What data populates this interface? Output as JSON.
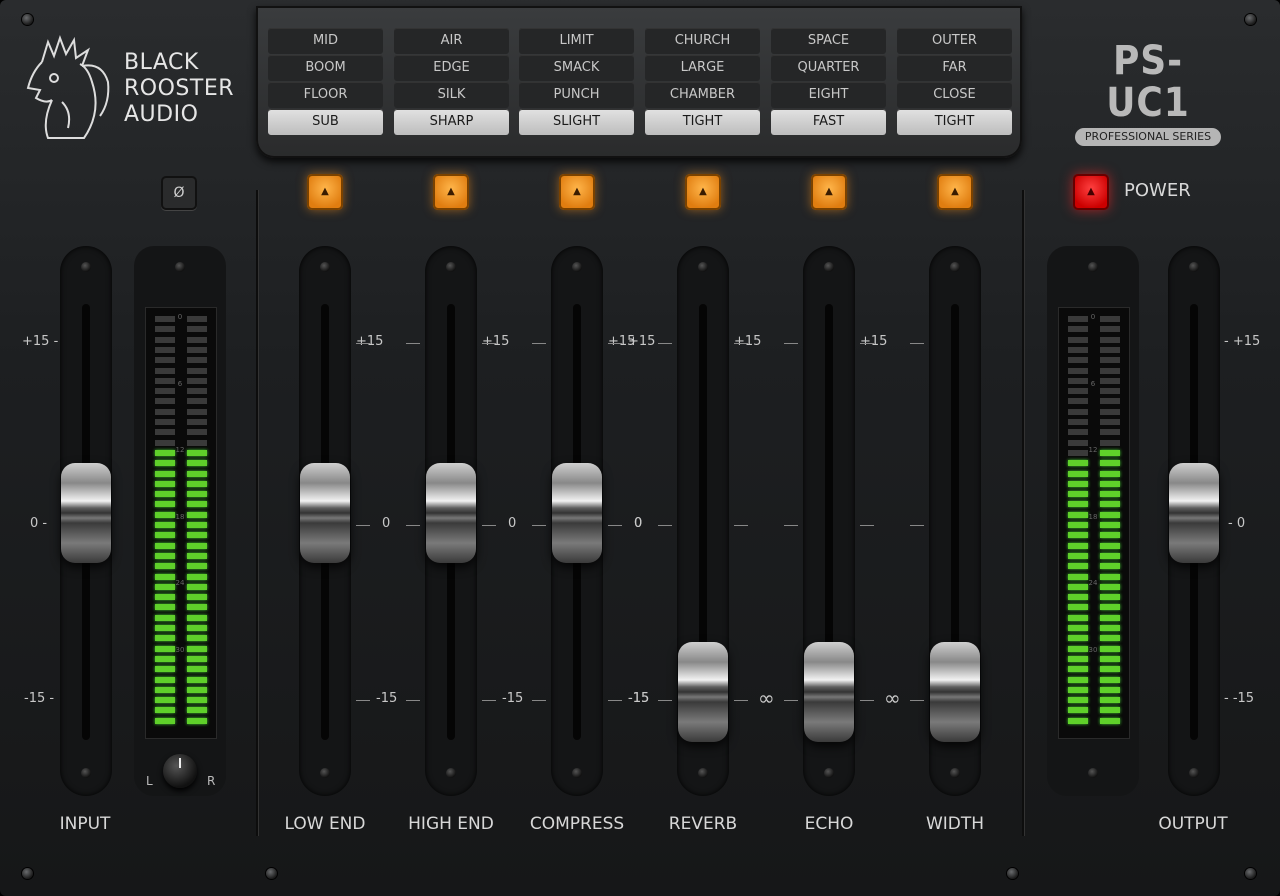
{
  "brand": {
    "line1": "BLACK",
    "line2": "ROOSTER",
    "line3": "AUDIO",
    "product": "PS-UC1",
    "series": "PROFESSIONAL SERIES"
  },
  "presets": [
    {
      "items": [
        "MID",
        "BOOM",
        "FLOOR",
        "SUB"
      ],
      "selected": 3
    },
    {
      "items": [
        "AIR",
        "EDGE",
        "SILK",
        "SHARP"
      ],
      "selected": 3
    },
    {
      "items": [
        "LIMIT",
        "SMACK",
        "PUNCH",
        "SLIGHT"
      ],
      "selected": 3
    },
    {
      "items": [
        "CHURCH",
        "LARGE",
        "CHAMBER",
        "TIGHT"
      ],
      "selected": 3
    },
    {
      "items": [
        "SPACE",
        "QUARTER",
        "EIGHT",
        "FAST"
      ],
      "selected": 3
    },
    {
      "items": [
        "OUTER",
        "FAR",
        "CLOSE",
        "TIGHT"
      ],
      "selected": 3
    }
  ],
  "phase_button": "Ø",
  "power": {
    "label": "POWER",
    "state": "on"
  },
  "amber_glyph": "▲",
  "scale": {
    "plus": "+15",
    "zero": "0",
    "minus": "-15",
    "inf": "∞",
    "plus_l": "+15 -",
    "zero_l": "0 -",
    "minus_l": "-15 -",
    "plus_r": "- +15",
    "zero_r": "- 0",
    "minus_r": "- -15"
  },
  "channels": [
    {
      "name": "LOW END",
      "value": "0"
    },
    {
      "name": "HIGH END",
      "value": "0"
    },
    {
      "name": "COMPRESS",
      "value": "0"
    },
    {
      "name": "REVERB",
      "value": "-inf"
    },
    {
      "name": "ECHO",
      "value": "-inf"
    },
    {
      "name": "WIDTH",
      "value": "-inf"
    }
  ],
  "input": {
    "label": "INPUT",
    "value": "0"
  },
  "output": {
    "label": "OUTPUT",
    "value": "0"
  },
  "meter_ticks": [
    "0",
    "6",
    "12",
    "18",
    "24",
    "30"
  ],
  "input_meter": {
    "left_lit": 0.68,
    "right_lit": 0.68
  },
  "output_meter": {
    "left_lit": 0.66,
    "right_lit": 0.68
  },
  "pan": {
    "left": "L",
    "right": "R"
  },
  "colors": {
    "amber": "#f59a20",
    "power": "#e02020",
    "meter_on": "#5fd02a"
  }
}
